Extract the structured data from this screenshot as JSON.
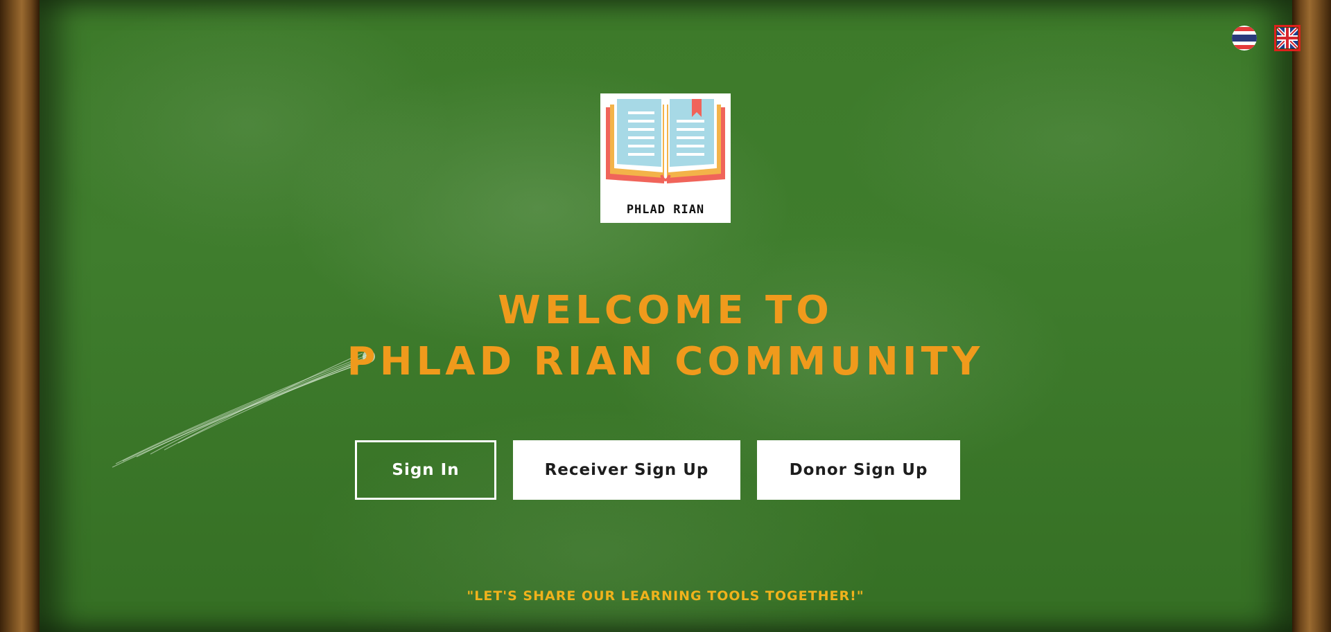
{
  "language_switcher": {
    "options": [
      {
        "icon": "thai-flag-icon",
        "label": "Thai"
      },
      {
        "icon": "uk-flag-icon",
        "label": "English",
        "selected": true
      }
    ]
  },
  "logo": {
    "text": "PHLAD RIAN"
  },
  "hero": {
    "title_line1": "WELCOME TO",
    "title_line2": "PHLAD RIAN COMMUNITY"
  },
  "actions": {
    "sign_in": "Sign In",
    "receiver_sign_up": "Receiver Sign Up",
    "donor_sign_up": "Donor Sign Up"
  },
  "tagline": "\"LET'S SHARE OUR LEARNING TOOLS TOGETHER!\"",
  "colors": {
    "headline": "#f09a1c",
    "tagline": "#f0b21c",
    "board": "#3f7d2d",
    "frame": "#7a5121",
    "active_flag_border": "#e0201c"
  }
}
